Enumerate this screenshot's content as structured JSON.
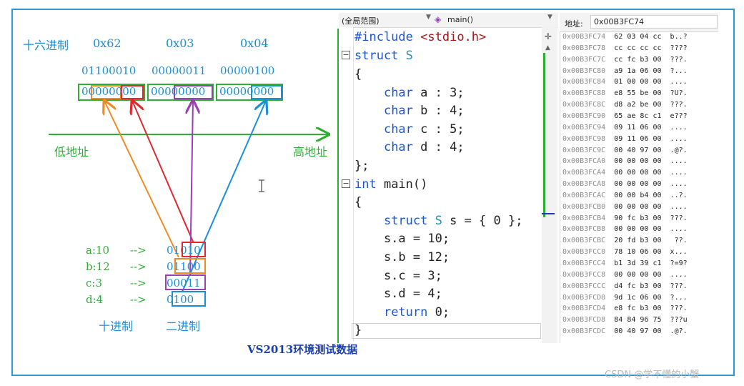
{
  "diagram": {
    "hex_label": "十六进制",
    "hex_values": [
      "0x62",
      "0x03",
      "0x04"
    ],
    "binary_values": [
      "01100010",
      "00000011",
      "00000100"
    ],
    "byte_boxes": [
      "00000000",
      "00000000",
      "00000000"
    ],
    "low_addr": "低地址",
    "high_addr": "高地址",
    "fields": [
      {
        "name": "a:10",
        "arrow": "-->",
        "bits": "01010"
      },
      {
        "name": "b:12",
        "arrow": "-->",
        "bits": "01100"
      },
      {
        "name": "c:3",
        "arrow": "-->",
        "bits": "00011"
      },
      {
        "name": "d:4",
        "arrow": "-->",
        "bits": "0100"
      }
    ],
    "decimal_label": "十进制",
    "binary_label": "二进制",
    "caption": "VS2013环境测试数据",
    "colors": {
      "orange": "#f08a24",
      "red": "#e0282e",
      "purple": "#9b3fb5",
      "blue": "#1a8fd8",
      "green": "#2fae36"
    }
  },
  "editor": {
    "scope_dropdown": "(全局范围)",
    "function_dropdown": "main()",
    "lines": [
      "#include <stdio.h>",
      "struct S",
      "{",
      "    char a : 3;",
      "    char b : 4;",
      "    char c : 5;",
      "    char d : 4;",
      "};",
      "int main()",
      "{",
      "    struct S s = { 0 };",
      "    s.a = 10;",
      "    s.b = 12;",
      "    s.c = 3;",
      "    s.d = 4;",
      "    return 0;",
      "}"
    ]
  },
  "memory": {
    "address_label": "地址:",
    "address_value": "0x00B3FC74",
    "rows": [
      {
        "addr": "0x00B3FC74",
        "bytes": "62 03 04 cc",
        "ascii": "b..?"
      },
      {
        "addr": "0x00B3FC78",
        "bytes": "cc cc cc cc",
        "ascii": "????"
      },
      {
        "addr": "0x00B3FC7C",
        "bytes": "cc fc b3 00",
        "ascii": "???."
      },
      {
        "addr": "0x00B3FC80",
        "bytes": "a9 1a 06 00",
        "ascii": "?..."
      },
      {
        "addr": "0x00B3FC84",
        "bytes": "01 00 00 00",
        "ascii": "...."
      },
      {
        "addr": "0x00B3FC88",
        "bytes": "e8 55 be 00",
        "ascii": "?U?."
      },
      {
        "addr": "0x00B3FC8C",
        "bytes": "d8 a2 be 00",
        "ascii": "???."
      },
      {
        "addr": "0x00B3FC90",
        "bytes": "65 ae 8c c1",
        "ascii": "e???"
      },
      {
        "addr": "0x00B3FC94",
        "bytes": "09 11 06 00",
        "ascii": "...."
      },
      {
        "addr": "0x00B3FC98",
        "bytes": "09 11 06 00",
        "ascii": "...."
      },
      {
        "addr": "0x00B3FC9C",
        "bytes": "00 40 97 00",
        "ascii": ".@?."
      },
      {
        "addr": "0x00B3FCA0",
        "bytes": "00 00 00 00",
        "ascii": "...."
      },
      {
        "addr": "0x00B3FCA4",
        "bytes": "00 00 00 00",
        "ascii": "...."
      },
      {
        "addr": "0x00B3FCA8",
        "bytes": "00 00 00 00",
        "ascii": "...."
      },
      {
        "addr": "0x00B3FCAC",
        "bytes": "00 00 b4 00",
        "ascii": "..?."
      },
      {
        "addr": "0x00B3FCB0",
        "bytes": "00 00 00 00",
        "ascii": "...."
      },
      {
        "addr": "0x00B3FCB4",
        "bytes": "90 fc b3 00",
        "ascii": "???."
      },
      {
        "addr": "0x00B3FCB8",
        "bytes": "00 00 00 00",
        "ascii": "...."
      },
      {
        "addr": "0x00B3FCBC",
        "bytes": "20 fd b3 00",
        "ascii": " ??."
      },
      {
        "addr": "0x00B3FCC0",
        "bytes": "78 10 06 00",
        "ascii": "x..."
      },
      {
        "addr": "0x00B3FCC4",
        "bytes": "b1 3d 39 c1",
        "ascii": "?=9?"
      },
      {
        "addr": "0x00B3FCC8",
        "bytes": "00 00 00 00",
        "ascii": "...."
      },
      {
        "addr": "0x00B3FCCC",
        "bytes": "d4 fc b3 00",
        "ascii": "???."
      },
      {
        "addr": "0x00B3FCD0",
        "bytes": "9d 1c 06 00",
        "ascii": "?..."
      },
      {
        "addr": "0x00B3FCD4",
        "bytes": "e8 fc b3 00",
        "ascii": "???."
      },
      {
        "addr": "0x00B3FCD8",
        "bytes": "84 84 96 75",
        "ascii": "???u"
      },
      {
        "addr": "0x00B3FCDC",
        "bytes": "00 40 97 00",
        "ascii": ".@?."
      }
    ]
  },
  "watermark": "CSDN @学不懂的小蟹"
}
